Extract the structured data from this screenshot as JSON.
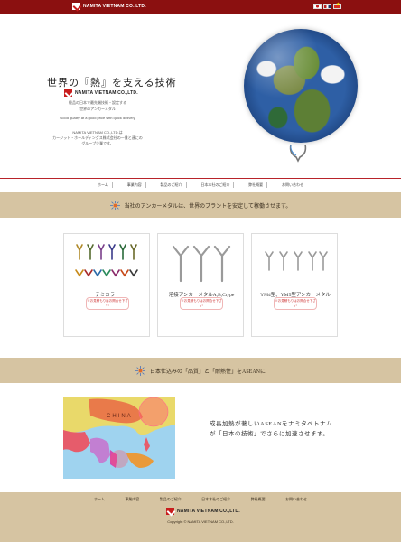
{
  "brand": {
    "name": "NAMITA VIETNAM CO.,LTD."
  },
  "header": {
    "flags": [
      "jp-flag-icon",
      "en-flag-icon",
      "vn-flag-icon"
    ]
  },
  "hero": {
    "title": "世界の『熱』を支える技術",
    "logo_text": "NAMITA VIETNAM CO.,LTD.",
    "lines": [
      "極品の日本で最先端技術・設定する",
      "世界のアンカーメタル"
    ],
    "english": "Good quality at a good price with quick delivery",
    "lines2": [
      "NAMITA VIETNAM CO.,LTD.は",
      "カージット・ホールディングス株式会社の一貫と連にの",
      "グループ企業です。"
    ]
  },
  "nav": {
    "items": [
      "ホーム",
      "事業内容",
      "製品のご紹介",
      "日本本社のご紹介",
      "弊社概要",
      "お問い合わせ"
    ]
  },
  "band1": {
    "text": "当社のアンカーメタルは、世界のプラントを安定して稼働させます。"
  },
  "cards": [
    {
      "title": "テミカラー",
      "price": "※お見積もりはお問合せ下さい"
    },
    {
      "title": "溶接アンカーメタルA,B,Ctype",
      "price": "※お見積もりはお問合せ下さい"
    },
    {
      "title": "YM4型、YM5型アンカーメタル",
      "price": "※お見積もりはお問合せ下さい"
    }
  ],
  "band2": {
    "text": "日本仕込みの「品質」と「耐熱性」をASEANに"
  },
  "map": {
    "label": "CHINA"
  },
  "map_text": "成長加熱が著しいASEANをナミタベトナムが「日本の技術」でさらに加速させます。",
  "footer": {
    "nav": [
      "ホーム",
      "事業内容",
      "製品のご紹介",
      "日本本社のご紹介",
      "弊社概要",
      "お問い合わせ"
    ],
    "logo_text": "NAMITA VIETNAM CO.,LTD.",
    "copyright": "Copyright © NAMITA VIETNAM CO.,LTD."
  },
  "colors": {
    "brand_red": "#8b1010",
    "accent_red": "#c81d1d",
    "band_tan": "#d6c4a2"
  }
}
